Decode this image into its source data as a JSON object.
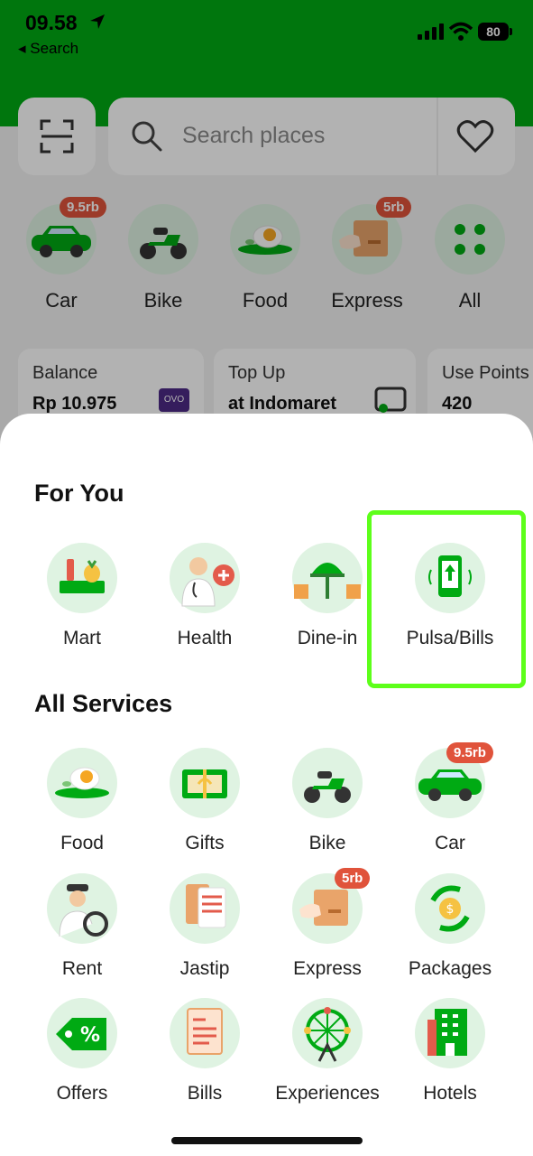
{
  "status_bar": {
    "time": "09.58",
    "back_label": "◂ Search",
    "battery": "80"
  },
  "header": {
    "search_placeholder": "Search places"
  },
  "top_services": [
    {
      "label": "Car",
      "badge": "9.5rb"
    },
    {
      "label": "Bike",
      "badge": ""
    },
    {
      "label": "Food",
      "badge": ""
    },
    {
      "label": "Express",
      "badge": "5rb"
    },
    {
      "label": "All",
      "badge": ""
    }
  ],
  "cards": [
    {
      "title": "Balance",
      "value": "Rp 10.975",
      "logo": "OVO"
    },
    {
      "title": "Top Up",
      "value": "at Indomaret"
    },
    {
      "title": "Use Points",
      "value": "420"
    }
  ],
  "sheet": {
    "for_you_title": "For You",
    "for_you": [
      {
        "label": "Mart",
        "icon": "mart-icon"
      },
      {
        "label": "Health",
        "icon": "health-icon"
      },
      {
        "label": "Dine-in",
        "icon": "dine-in-icon"
      },
      {
        "label": "Pulsa/Bills",
        "icon": "pulsa-bills-icon"
      }
    ],
    "all_title": "All Services",
    "all_services": [
      {
        "label": "Food",
        "icon": "food-icon",
        "badge": ""
      },
      {
        "label": "Gifts",
        "icon": "gift-icon",
        "badge": ""
      },
      {
        "label": "Bike",
        "icon": "bike-icon",
        "badge": ""
      },
      {
        "label": "Car",
        "icon": "car-icon",
        "badge": "9.5rb"
      },
      {
        "label": "Rent",
        "icon": "rent-icon",
        "badge": ""
      },
      {
        "label": "Jastip",
        "icon": "jastip-icon",
        "badge": ""
      },
      {
        "label": "Express",
        "icon": "express-icon",
        "badge": "5rb"
      },
      {
        "label": "Packages",
        "icon": "packages-icon",
        "badge": ""
      },
      {
        "label": "Offers",
        "icon": "offers-icon",
        "badge": ""
      },
      {
        "label": "Bills",
        "icon": "bills-icon",
        "badge": ""
      },
      {
        "label": "Experiences",
        "icon": "experiences-icon",
        "badge": ""
      },
      {
        "label": "Hotels",
        "icon": "hotels-icon",
        "badge": ""
      }
    ]
  },
  "colors": {
    "brand_green": "#00aa13",
    "icon_bg": "#dff3e2",
    "badge_red": "#e0533b",
    "highlight": "#5dff1a"
  }
}
